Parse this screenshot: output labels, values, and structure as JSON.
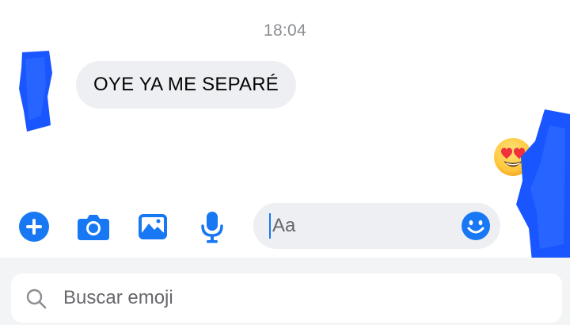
{
  "conversation": {
    "timestamp": "18:04",
    "incoming_message": {
      "text": "OYE YA ME SEPARÉ"
    },
    "reaction": {
      "icon": "heart-eyes-emoji-icon"
    }
  },
  "composer": {
    "tools": [
      {
        "icon": "plus-icon"
      },
      {
        "icon": "camera-icon"
      },
      {
        "icon": "gallery-icon"
      },
      {
        "icon": "microphone-icon"
      }
    ],
    "message_field": {
      "value": "",
      "placeholder": "Aa"
    },
    "emoji_button_icon": "smiley-icon"
  },
  "emoji_search": {
    "placeholder": "Buscar emoji",
    "icon": "search-icon"
  },
  "colors": {
    "accent": "#1877f2",
    "bubble": "#eeeff2",
    "redaction": "#1a56ff",
    "panel": "#f3f4f6"
  }
}
